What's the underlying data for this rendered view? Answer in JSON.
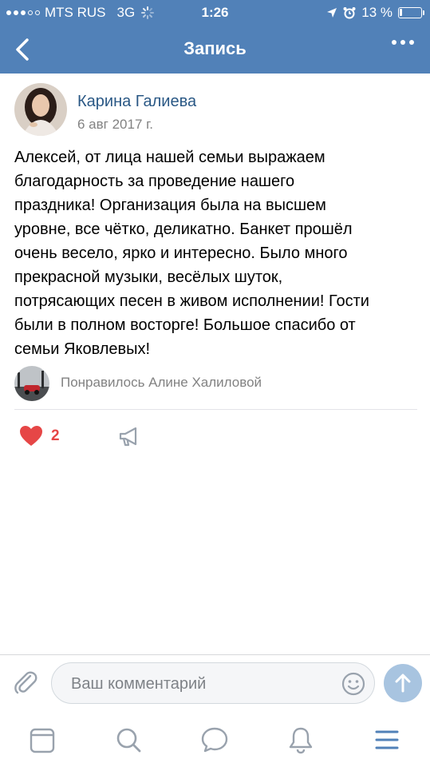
{
  "status_bar": {
    "carrier": "MTS RUS",
    "network": "3G",
    "time": "1:26",
    "battery_percent": "13 %",
    "battery_level": 0.13
  },
  "navbar": {
    "title": "Запись",
    "back_icon": "chevron-left-icon",
    "more_icon": "more-dots-icon"
  },
  "post": {
    "author": "Карина Галиева",
    "date": "6 авг 2017 г.",
    "text_lines": [
      "Алексей, от лица нашей семьи выражаем",
      "благодарность за проведение нашего",
      "праздника! Организация была на высшем",
      "уровне, все чётко, деликатно. Банкет прошёл",
      "очень весело, ярко и интересно. Было много",
      "прекрасной музыки, весёлых шуток,",
      "потрясающих песен в живом исполнении! Гости",
      "были в полном восторге! Большое спасибо от",
      "семьи Яковлевых!"
    ],
    "liked_by": "Понравилось Алине Халиловой",
    "likes_count": "2"
  },
  "comment": {
    "placeholder": "Ваш комментарий"
  },
  "tabbar": {
    "items": [
      "news-icon",
      "search-icon",
      "messages-icon",
      "notifications-icon",
      "menu-icon"
    ],
    "active": "menu-icon"
  },
  "colors": {
    "brand": "#5181b8",
    "link": "#2a5885",
    "like": "#e64646",
    "muted": "#828282"
  }
}
